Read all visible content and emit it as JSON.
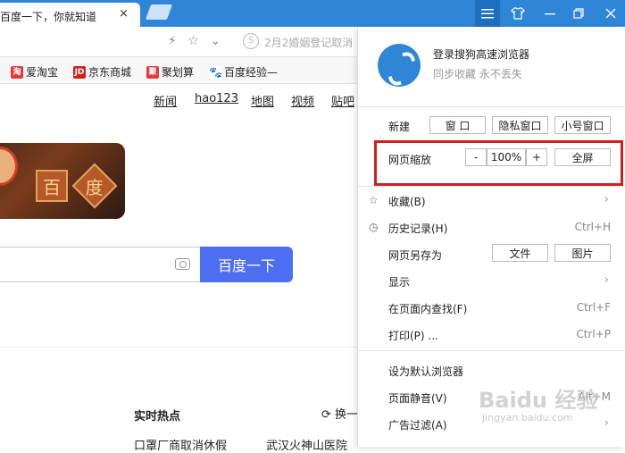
{
  "tab": {
    "title": "百度一下，你就知道",
    "close": "×"
  },
  "address": {
    "hint_text": "2月2婚姻登记取消"
  },
  "bookmarks": [
    {
      "label": "爱淘宝",
      "icon": "taobao-icon",
      "color": "#e4393c"
    },
    {
      "label": "京东商城",
      "icon": "jd-icon",
      "color": "#d21e1e"
    },
    {
      "label": "聚划算",
      "icon": "juhuasuan-icon",
      "color": "#e4393c"
    },
    {
      "label": "百度经验—",
      "icon": "baidu-paw-icon",
      "color": "#2f86d6"
    }
  ],
  "nav": [
    "新闻",
    "hao123",
    "地图",
    "视频",
    "贴吧"
  ],
  "doodle_chars": [
    "百",
    "度"
  ],
  "search": {
    "button_label": "百度一下"
  },
  "hot": {
    "title": "实时热点",
    "refresh_label": "换一",
    "items": [
      "口罩厂商取消休假",
      "武汉火神山医院"
    ]
  },
  "menu": {
    "login_title": "登录搜狗高速浏览器",
    "login_subtitle": "同步收藏 永不丢失",
    "new_label": "新建",
    "new_buttons": [
      "窗 口",
      "隐私窗口",
      "小号窗口"
    ],
    "zoom_label": "网页缩放",
    "zoom_minus": "-",
    "zoom_value": "100%",
    "zoom_plus": "+",
    "fullscreen": "全屏",
    "items": [
      {
        "label": "收藏(B)",
        "shortcut": "",
        "arrow": "›"
      },
      {
        "label": "历史记录(H)",
        "shortcut": "Ctrl+H"
      },
      {
        "label": "网页另存为",
        "shortcut": ""
      },
      {
        "label": "显示",
        "shortcut": "",
        "arrow": "›"
      },
      {
        "label": "在页面内查找(F)",
        "shortcut": "Ctrl+F"
      },
      {
        "label": "打印(P) ...",
        "shortcut": "Ctrl+P"
      },
      {
        "label": "设为默认浏览器",
        "shortcut": ""
      },
      {
        "label": "页面静音(V)",
        "shortcut": "Alt+M"
      },
      {
        "label": "广告过滤(A)",
        "shortcut": "",
        "arrow": "›"
      }
    ],
    "save_buttons": [
      "文件",
      "图片"
    ]
  },
  "watermark": {
    "main": "Baidu 经验",
    "sub": "jingyan.baidu.com"
  },
  "colors": {
    "brand": "#2f86d6",
    "search_button": "#4e6ef2",
    "highlight": "#d21e1e"
  }
}
